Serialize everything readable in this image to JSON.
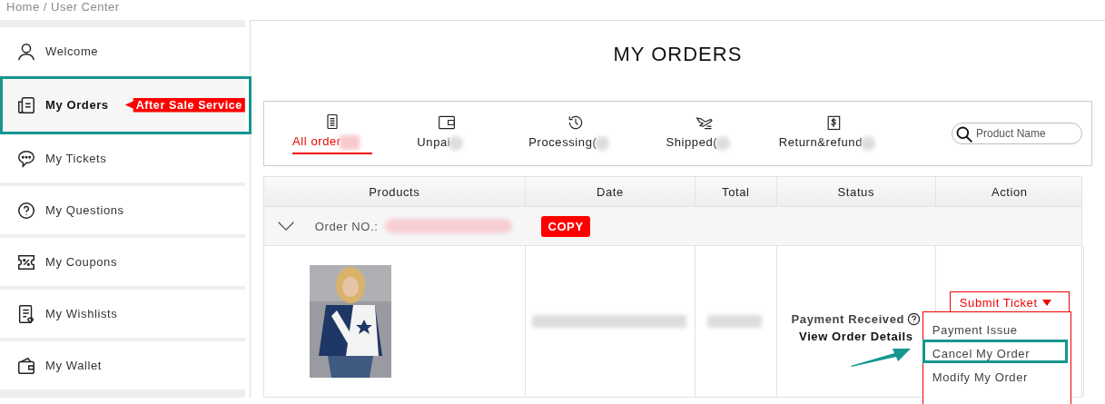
{
  "breadcrumb": "Home / User Center",
  "sidebar": {
    "items": [
      {
        "label": "Welcome",
        "selected": false,
        "annotated": false
      },
      {
        "label": "My Orders",
        "selected": true,
        "annotated": true,
        "badge": "After Sale Service"
      },
      {
        "label": "My Tickets",
        "selected": false,
        "annotated": false
      },
      {
        "label": "My Questions",
        "selected": false,
        "annotated": false
      },
      {
        "label": "My Coupons",
        "selected": false,
        "annotated": false
      },
      {
        "label": "My Wishlists",
        "selected": false,
        "annotated": false
      },
      {
        "label": "My Wallet",
        "selected": false,
        "annotated": false
      }
    ]
  },
  "title": "MY ORDERS",
  "tabs": [
    {
      "label": "All order",
      "selected": true
    },
    {
      "label": "Unpai",
      "selected": false
    },
    {
      "label": "Processing(",
      "selected": false
    },
    {
      "label": "Shipped(",
      "selected": false
    },
    {
      "label": "Return&refund",
      "selected": false
    }
  ],
  "search": {
    "placeholder": "Product Name"
  },
  "table": {
    "columns": [
      "Products",
      "Date",
      "Total",
      "Status",
      "Action"
    ],
    "order": {
      "label": "Order NO.:",
      "copy_button": "COPY",
      "expanded": false
    },
    "row": {
      "status": "Payment Received",
      "details_link": "View Order Details",
      "action": {
        "label": "Submit Ticket",
        "menu": [
          {
            "label": "Payment Issue",
            "annotated": false
          },
          {
            "label": "Cancel My Order",
            "annotated": true
          },
          {
            "label": "Modify My Order",
            "annotated": false
          }
        ]
      }
    }
  }
}
